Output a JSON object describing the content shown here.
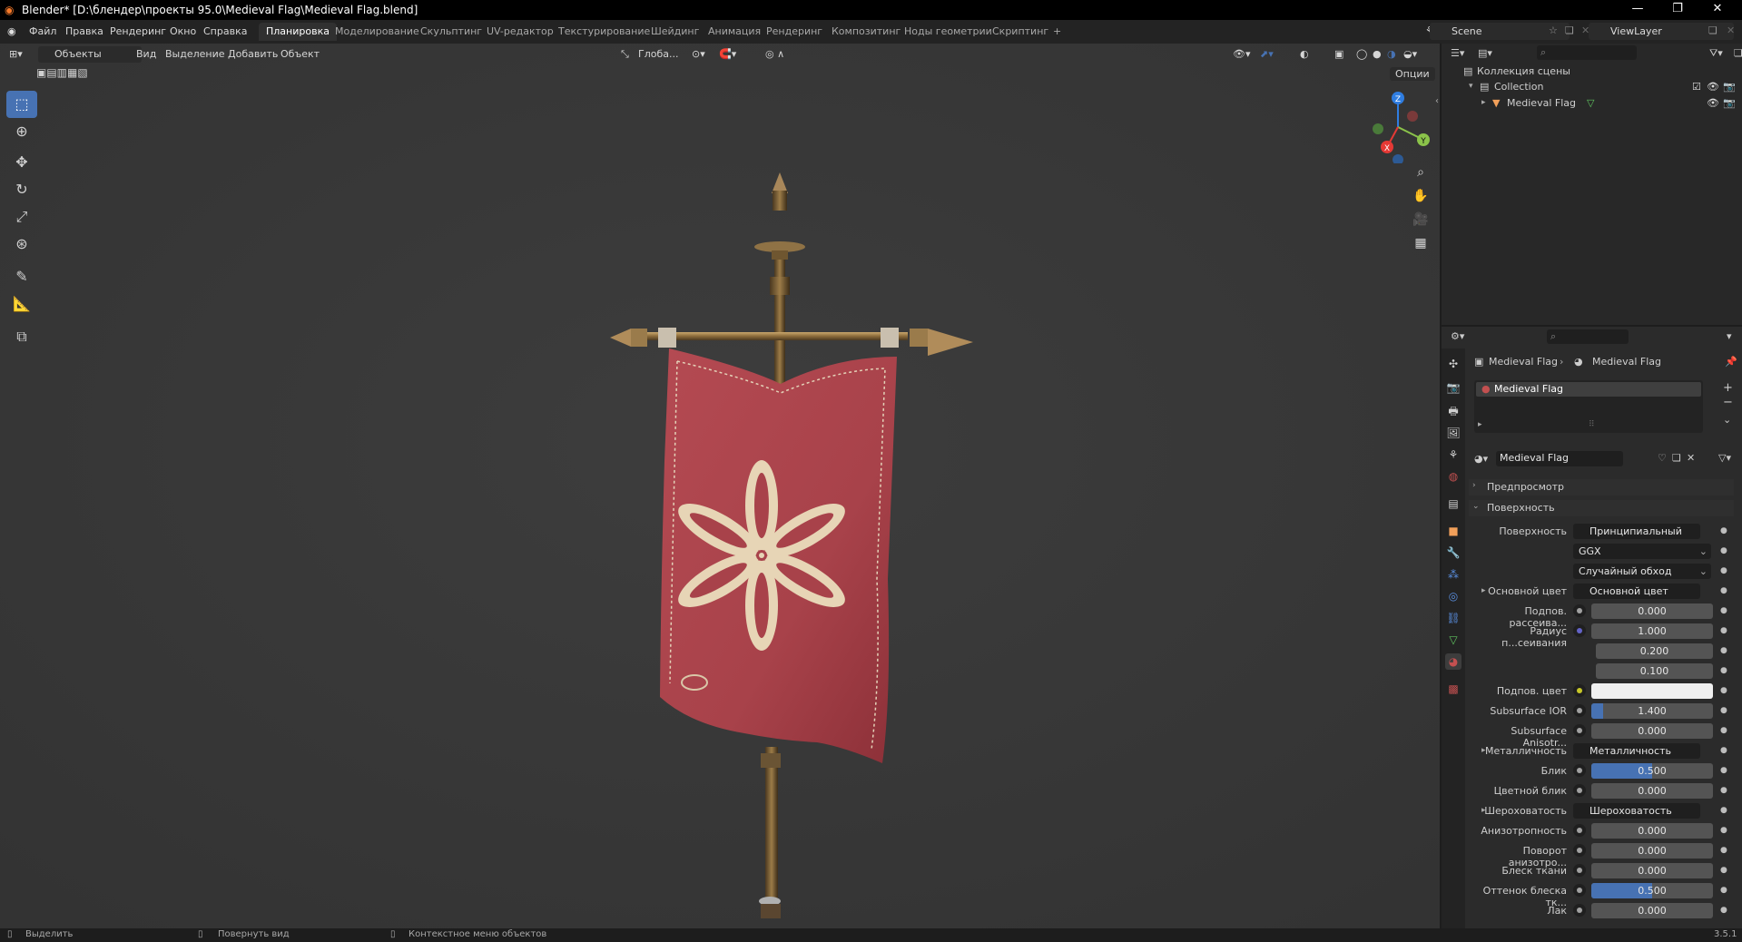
{
  "window": {
    "title": "Blender* [D:\\блендер\\проекты 95.0\\Medieval Flag\\Medieval Flag.blend]",
    "controls": [
      "—",
      "❐",
      "✕"
    ]
  },
  "menu": [
    "Файл",
    "Правка",
    "Рендеринг",
    "Окно",
    "Справка"
  ],
  "workspaces": [
    {
      "label": "Планировка",
      "active": true
    },
    {
      "label": "Моделирование"
    },
    {
      "label": "Скульптинг"
    },
    {
      "label": "UV-редактор"
    },
    {
      "label": "Текстурирование"
    },
    {
      "label": "Шейдинг"
    },
    {
      "label": "Анимация"
    },
    {
      "label": "Рендеринг"
    },
    {
      "label": "Композитинг"
    },
    {
      "label": "Ноды геометрии"
    },
    {
      "label": "Скриптинг"
    }
  ],
  "add_workspace": "+",
  "scene_name": "Scene",
  "view_layer": "ViewLayer",
  "viewport": {
    "mode": "Объекты",
    "menus": [
      "Вид",
      "Выделение",
      "Добавить",
      "Объект"
    ],
    "transform_orientation": "Глоба...",
    "options_label": "Опции",
    "gizmo_axes": {
      "x": "X",
      "y": "Y",
      "z": "Z"
    }
  },
  "outliner": {
    "root": "Коллекция сцены",
    "collection": "Collection",
    "object": "Medieval Flag"
  },
  "properties": {
    "breadcrumb_object": "Medieval Flag",
    "breadcrumb_material": "Medieval Flag",
    "slot_name": "Medieval Flag",
    "material_name": "Medieval Flag",
    "panel_preview": "Предпросмотр",
    "panel_surface": "Поверхность",
    "rows": [
      {
        "label": "Поверхность",
        "value": "Принципиальный BSDF",
        "kind": "link",
        "socket": "#63c763"
      },
      {
        "label": "",
        "value": "GGX",
        "kind": "select"
      },
      {
        "label": "",
        "value": "Случайный обход",
        "kind": "select"
      },
      {
        "label": "Основной цвет",
        "value": "Основной цвет",
        "kind": "link",
        "socket": "#c7c729",
        "expand": true
      },
      {
        "label": "Подпов. рассеива...",
        "value": "0.000",
        "kind": "num",
        "socket": "#a1a1a1"
      },
      {
        "label": "Радиус п...сеивания",
        "value": "1.000",
        "kind": "num",
        "socket": "#6363c7"
      },
      {
        "label": "",
        "value": "0.200",
        "kind": "num"
      },
      {
        "label": "",
        "value": "0.100",
        "kind": "num"
      },
      {
        "label": "Подпов. цвет",
        "value": "",
        "kind": "color",
        "socket": "#c7c729"
      },
      {
        "label": "Subsurface IOR",
        "value": "1.400",
        "kind": "num",
        "socket": "#a1a1a1",
        "fill": 0.1
      },
      {
        "label": "Subsurface Anisotr...",
        "value": "0.000",
        "kind": "num",
        "socket": "#a1a1a1"
      },
      {
        "label": "Металличность",
        "value": "Металличность",
        "kind": "link",
        "socket": "#a1a1a1",
        "expand": true
      },
      {
        "label": "Блик",
        "value": "0.500",
        "kind": "num",
        "socket": "#a1a1a1",
        "fill": 0.5
      },
      {
        "label": "Цветной блик",
        "value": "0.000",
        "kind": "num",
        "socket": "#a1a1a1"
      },
      {
        "label": "Шероховатость",
        "value": "Шероховатость",
        "kind": "link",
        "socket": "#a1a1a1",
        "expand": true
      },
      {
        "label": "Анизотропность",
        "value": "0.000",
        "kind": "num",
        "socket": "#a1a1a1"
      },
      {
        "label": "Поворот анизотро...",
        "value": "0.000",
        "kind": "num",
        "socket": "#a1a1a1"
      },
      {
        "label": "Блеск ткани",
        "value": "0.000",
        "kind": "num",
        "socket": "#a1a1a1"
      },
      {
        "label": "Оттенок блеска тк...",
        "value": "0.500",
        "kind": "num",
        "socket": "#a1a1a1",
        "fill": 0.5
      },
      {
        "label": "Лак",
        "value": "0.000",
        "kind": "num",
        "socket": "#a1a1a1"
      }
    ]
  },
  "status": {
    "select": "Выделить",
    "rotate": "Повернуть вид",
    "context": "Контекстное меню объектов",
    "version": "3.5.1"
  }
}
